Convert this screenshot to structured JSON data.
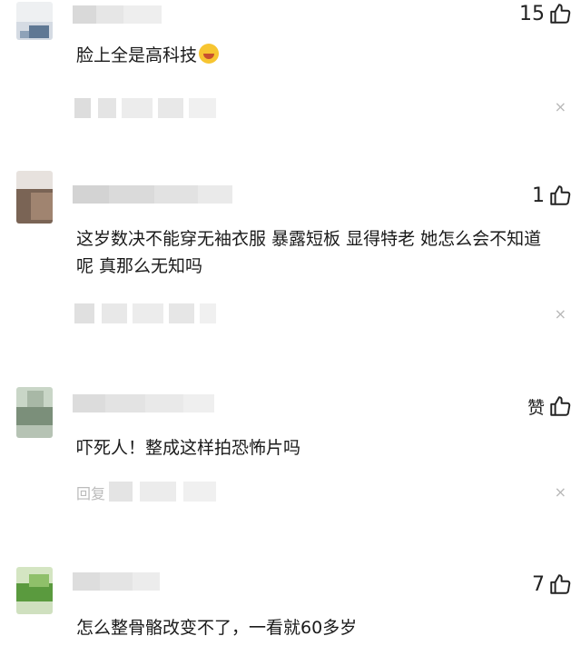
{
  "comments": [
    {
      "likes": "15",
      "text": "脸上全是高科技",
      "reaction_icon": "laughing-crying-emoji",
      "close_glyph": "×"
    },
    {
      "likes": "1",
      "text": "这岁数决不能穿无袖衣服 暴露短板 显得特老 她怎么会不知道呢 真那么无知吗",
      "close_glyph": "×"
    },
    {
      "likes": "赞",
      "text": "吓死人！整成这样拍恐怖片吗",
      "meta_label": "回复",
      "close_glyph": "×"
    },
    {
      "likes": "7",
      "text": "怎么整骨骼改变不了，一看就60多岁"
    }
  ],
  "icons": {
    "like": "thumbs-up-icon",
    "close": "close-icon"
  },
  "colors": {
    "text": "#1a1a1a",
    "muted": "#b8b8b8",
    "blur": "#d9d9d9"
  }
}
